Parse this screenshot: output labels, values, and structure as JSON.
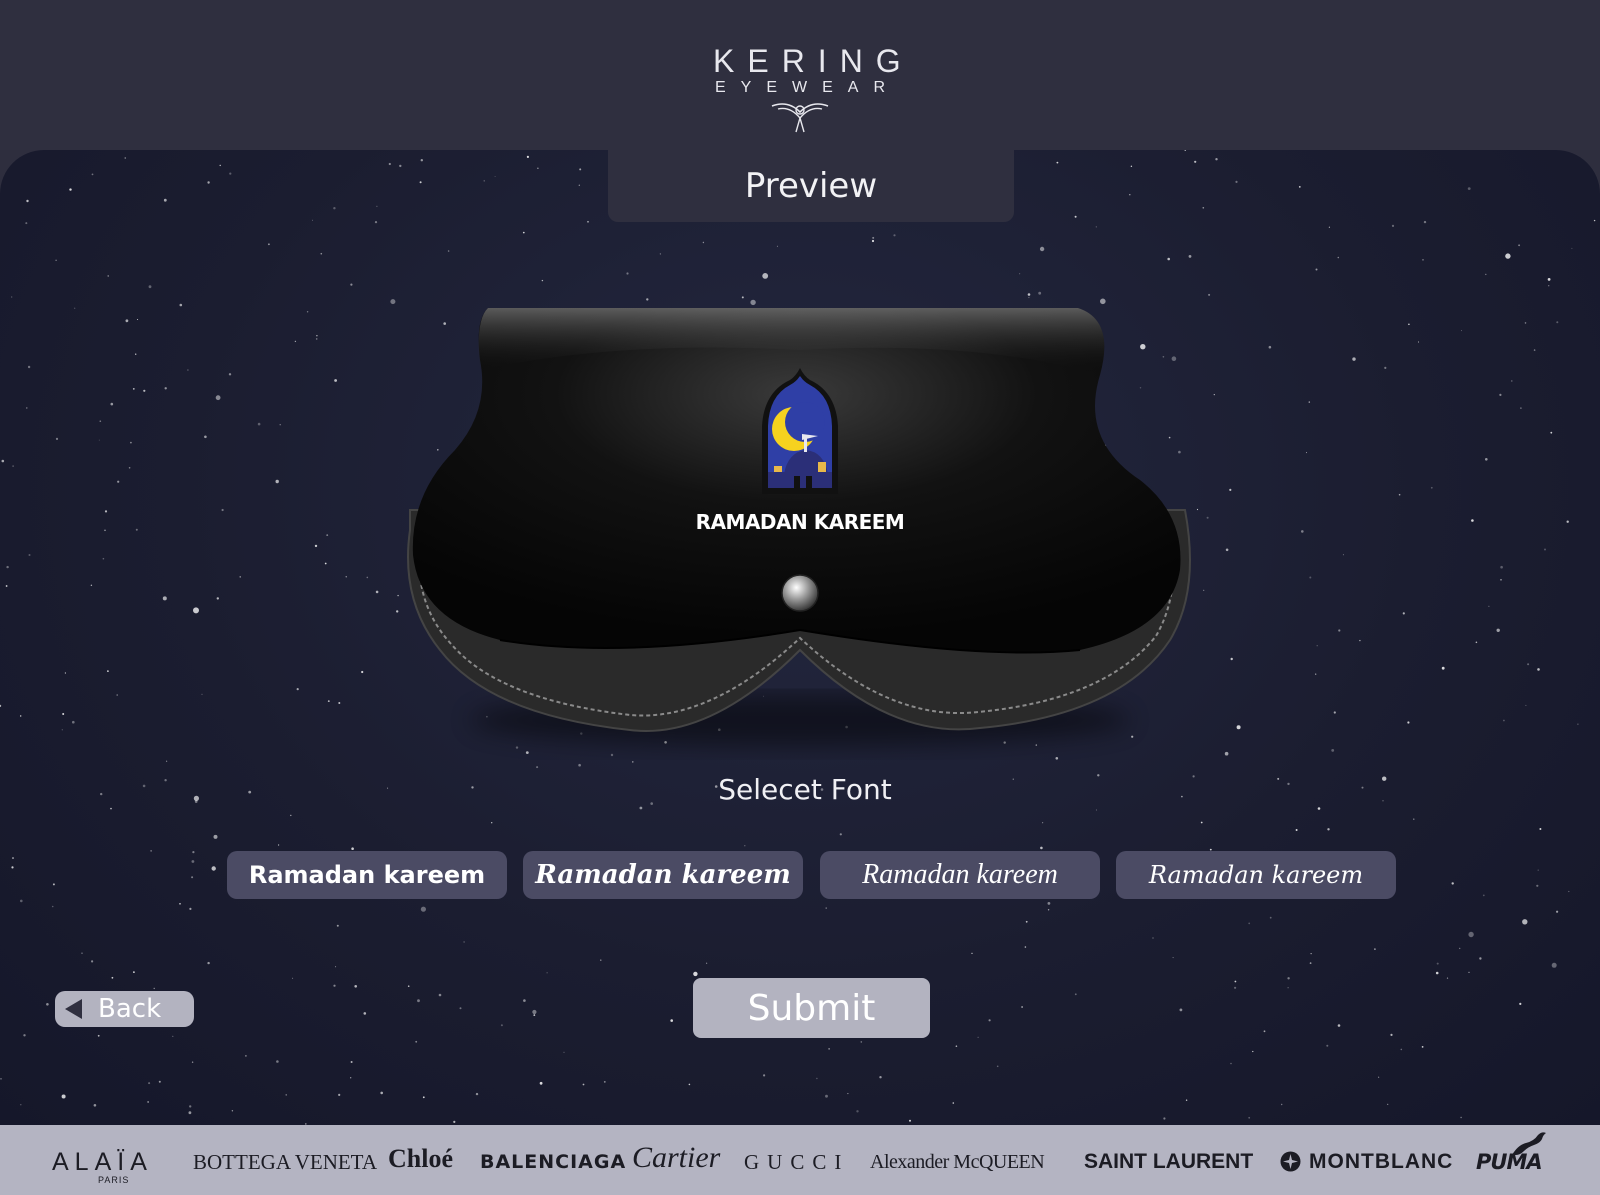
{
  "header": {
    "logo_main": "KERING",
    "logo_sub": "EYEWEAR"
  },
  "preview_tab": {
    "label": "Preview"
  },
  "product": {
    "item": "leather glasses case",
    "badge_icon": "crescent-moon-mosque-icon",
    "engraving_text": "RAMADAN KAREEM"
  },
  "font_selector": {
    "label": "Selecet Font",
    "options": [
      {
        "label": "Ramadan kareem",
        "style": "bold sans"
      },
      {
        "label": "Ramadan kareem",
        "style": "bold brush script"
      },
      {
        "label": "Ramadan kareem",
        "style": "casual script"
      },
      {
        "label": "Ramadan kareem",
        "style": "elegant script"
      }
    ]
  },
  "actions": {
    "back_label": "Back",
    "submit_label": "Submit"
  },
  "brands": {
    "alaia": "ALAÏA",
    "alaia_sub": "PARIS",
    "bottega": "BOTTEGA VENETA",
    "chloe": "Chloé",
    "balenciaga": "BALENCIAGA",
    "cartier": "Cartier",
    "gucci": "GUCCI",
    "mcqueen": "Alexander McQUEEN",
    "saint_laurent": "SAINT LAURENT",
    "montblanc": "MONTBLANC",
    "puma": "PUMA"
  },
  "colors": {
    "header_bg": "#2f2f3f",
    "stage_bg": "#1b1d30",
    "font_button_bg": "#4b4b64",
    "action_button_bg": "#b3b3c0",
    "brand_bar_bg": "#b4b4c2",
    "badge_blue": "#2f3fa6",
    "moon_yellow": "#f6d21f"
  }
}
